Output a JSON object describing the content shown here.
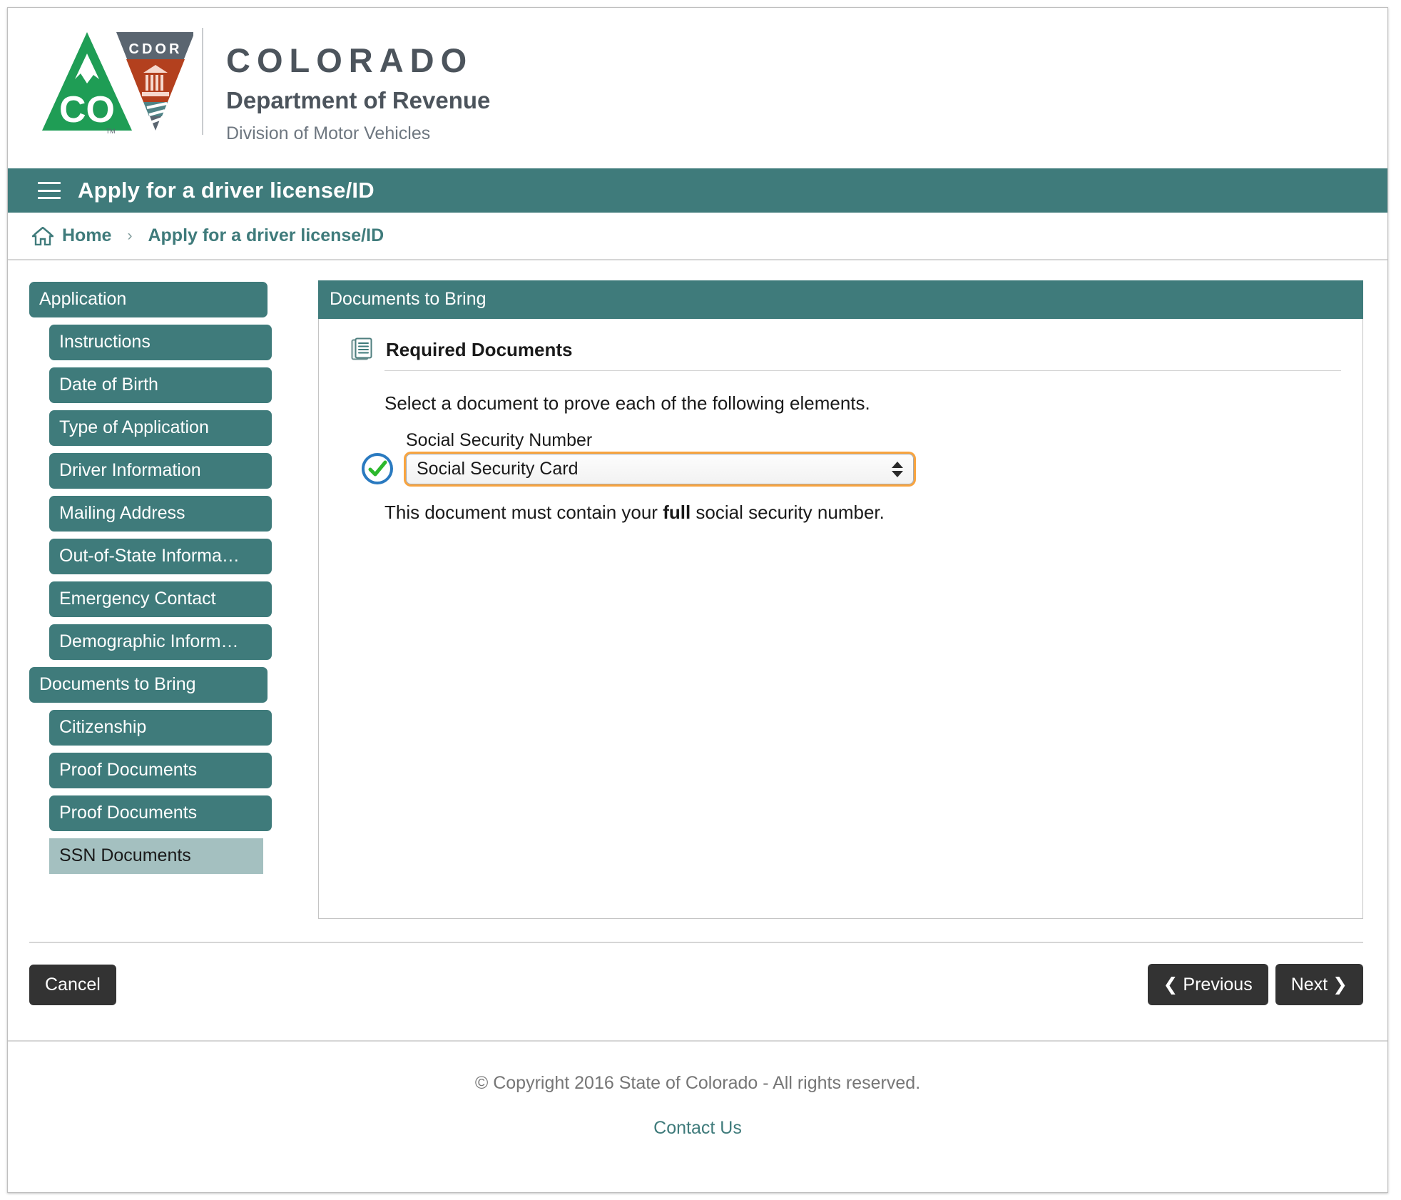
{
  "logo": {
    "state_name": "COLORADO",
    "department": "Department of Revenue",
    "division": "Division of Motor Vehicles",
    "badge_text": "CDOR",
    "co_abbrev": "CO",
    "trademark": "TM",
    "colors": {
      "green": "#1f9d55",
      "grey": "#5a6570",
      "red": "#b3401e",
      "teal_accent": "#3f7b7b"
    }
  },
  "app_bar": {
    "menu_icon": "hamburger-icon",
    "title": "Apply for a driver license/ID"
  },
  "breadcrumb": {
    "home_icon": "home-icon",
    "home_label": "Home",
    "separator": "›",
    "current_label": "Apply for a driver license/ID"
  },
  "sidebar": {
    "items": [
      {
        "label": "Application",
        "level": "group",
        "active": false
      },
      {
        "label": "Instructions",
        "level": "child",
        "active": false
      },
      {
        "label": "Date of Birth",
        "level": "child",
        "active": false
      },
      {
        "label": "Type of Application",
        "level": "child",
        "active": false
      },
      {
        "label": "Driver Information",
        "level": "child",
        "active": false
      },
      {
        "label": "Mailing Address",
        "level": "child",
        "active": false
      },
      {
        "label": "Out-of-State Informa…",
        "level": "child",
        "active": false
      },
      {
        "label": "Emergency Contact",
        "level": "child",
        "active": false
      },
      {
        "label": "Demographic Inform…",
        "level": "child",
        "active": false
      },
      {
        "label": "Documents to Bring",
        "level": "group",
        "active": false
      },
      {
        "label": "Citizenship",
        "level": "child",
        "active": false
      },
      {
        "label": "Proof Documents",
        "level": "child",
        "active": false
      },
      {
        "label": "Proof Documents",
        "level": "child",
        "active": false
      },
      {
        "label": "SSN Documents",
        "level": "child",
        "active": true
      }
    ]
  },
  "panel": {
    "header": "Documents to Bring",
    "section_icon": "document-list-icon",
    "section_title": "Required Documents",
    "instruction": "Select a document to prove each of the following elements.",
    "field": {
      "status_icon": "check-circle-icon",
      "label": "Social Security Number",
      "selected_value": "Social Security Card",
      "stepper_icon": "up-down-stepper-icon",
      "options": [
        "Social Security Card"
      ],
      "focus_ring_color": "#f7941d"
    },
    "help_text_before": "This document must contain your ",
    "help_text_bold": "full",
    "help_text_after": " social security number."
  },
  "actions": {
    "cancel_label": "Cancel",
    "previous_label": "Previous",
    "previous_icon": "chevron-left-icon",
    "next_label": "Next",
    "next_icon": "chevron-right-icon"
  },
  "footer": {
    "copyright": "© Copyright 2016 State of Colorado - All rights reserved.",
    "contact_label": "Contact Us"
  }
}
